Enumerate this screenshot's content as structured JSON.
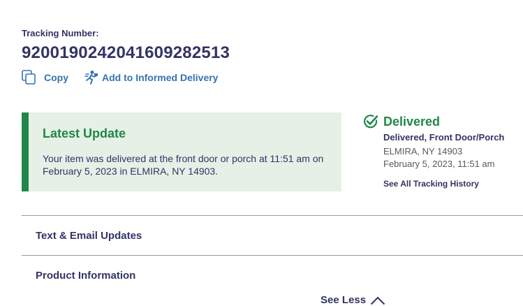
{
  "tracking": {
    "label": "Tracking Number:",
    "number": "9200190242041609282513"
  },
  "actions": {
    "copy_label": "Copy",
    "informed_label": "Add to Informed Delivery"
  },
  "latest_update": {
    "title": "Latest Update",
    "text": "Your item was delivered at the front door or porch at 11:51 am on February 5, 2023 in ELMIRA, NY 14903."
  },
  "status": {
    "title": "Delivered",
    "detail": "Delivered, Front Door/Porch",
    "location": "ELMIRA, NY 14903",
    "time": "February 5, 2023, 11:51 am",
    "history_link": "See All Tracking History"
  },
  "sections": {
    "text_email": "Text & Email Updates",
    "product_info": "Product Information"
  },
  "see_less_label": "See Less",
  "colors": {
    "navy": "#333366",
    "link_blue": "#3573b1",
    "green": "#218748",
    "light_green": "#e6f0e6"
  },
  "icons": {
    "copy": "copy-icon",
    "informed": "carrier-running-icon",
    "delivered": "check-circle-icon",
    "see_less": "chevron-up-icon"
  }
}
